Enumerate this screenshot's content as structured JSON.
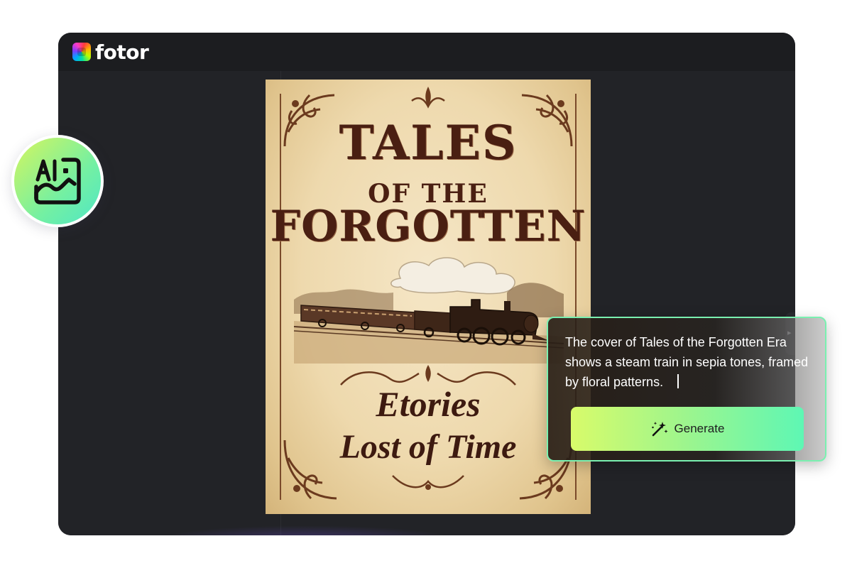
{
  "app": {
    "logo_text": "fotor"
  },
  "poster": {
    "title_line_1": "TALES",
    "title_line_2": "OF THE",
    "title_line_3": "FORGOTTEN",
    "subtitle_line_1": "Etories",
    "subtitle_line_2": "Lost of Time"
  },
  "ai_badge": {
    "icon": "ai-image-icon"
  },
  "prompt": {
    "text": "The cover of Tales of the Forgotten Era shows a steam train in sepia tones, framed by floral patterns.",
    "generate_label": "Generate",
    "generate_icon": "magic-wand-icon"
  },
  "colors": {
    "accent_start": "#d8fb6a",
    "accent_end": "#5ef7b4",
    "window_bg": "#222327",
    "topbar_bg": "#1c1d20",
    "poster_ink": "#4a1f12"
  }
}
